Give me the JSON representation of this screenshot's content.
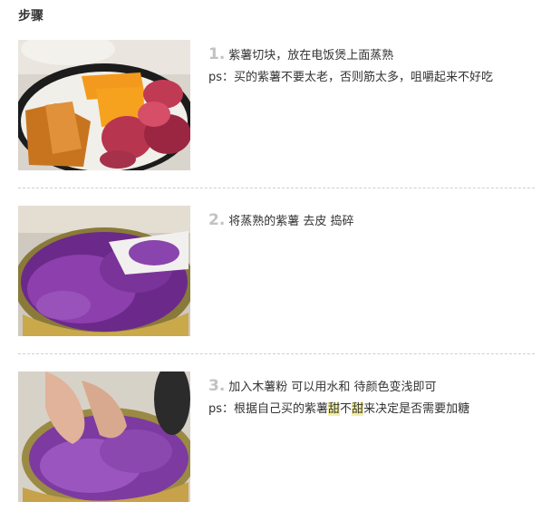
{
  "section_title": "步骤",
  "steps": [
    {
      "number": "1.",
      "text": "紫薯切块，放在电饭煲上面蒸熟",
      "note": "ps：买的紫薯不要太老，否则筋太多，咀嚼起来不好吃"
    },
    {
      "number": "2.",
      "text": "将蒸熟的紫薯 去皮 捣碎"
    },
    {
      "number": "3.",
      "text": "加入木薯粉 可以用水和 待颜色变浅即可",
      "note_parts": [
        "ps：根据自己买的紫薯",
        "甜",
        "不",
        "甜",
        "来决定是否需要加糖"
      ]
    }
  ],
  "colors": {
    "step_number": "#c2c2c2",
    "highlight": "#f4f0a4",
    "divider": "#cfcfcf"
  }
}
